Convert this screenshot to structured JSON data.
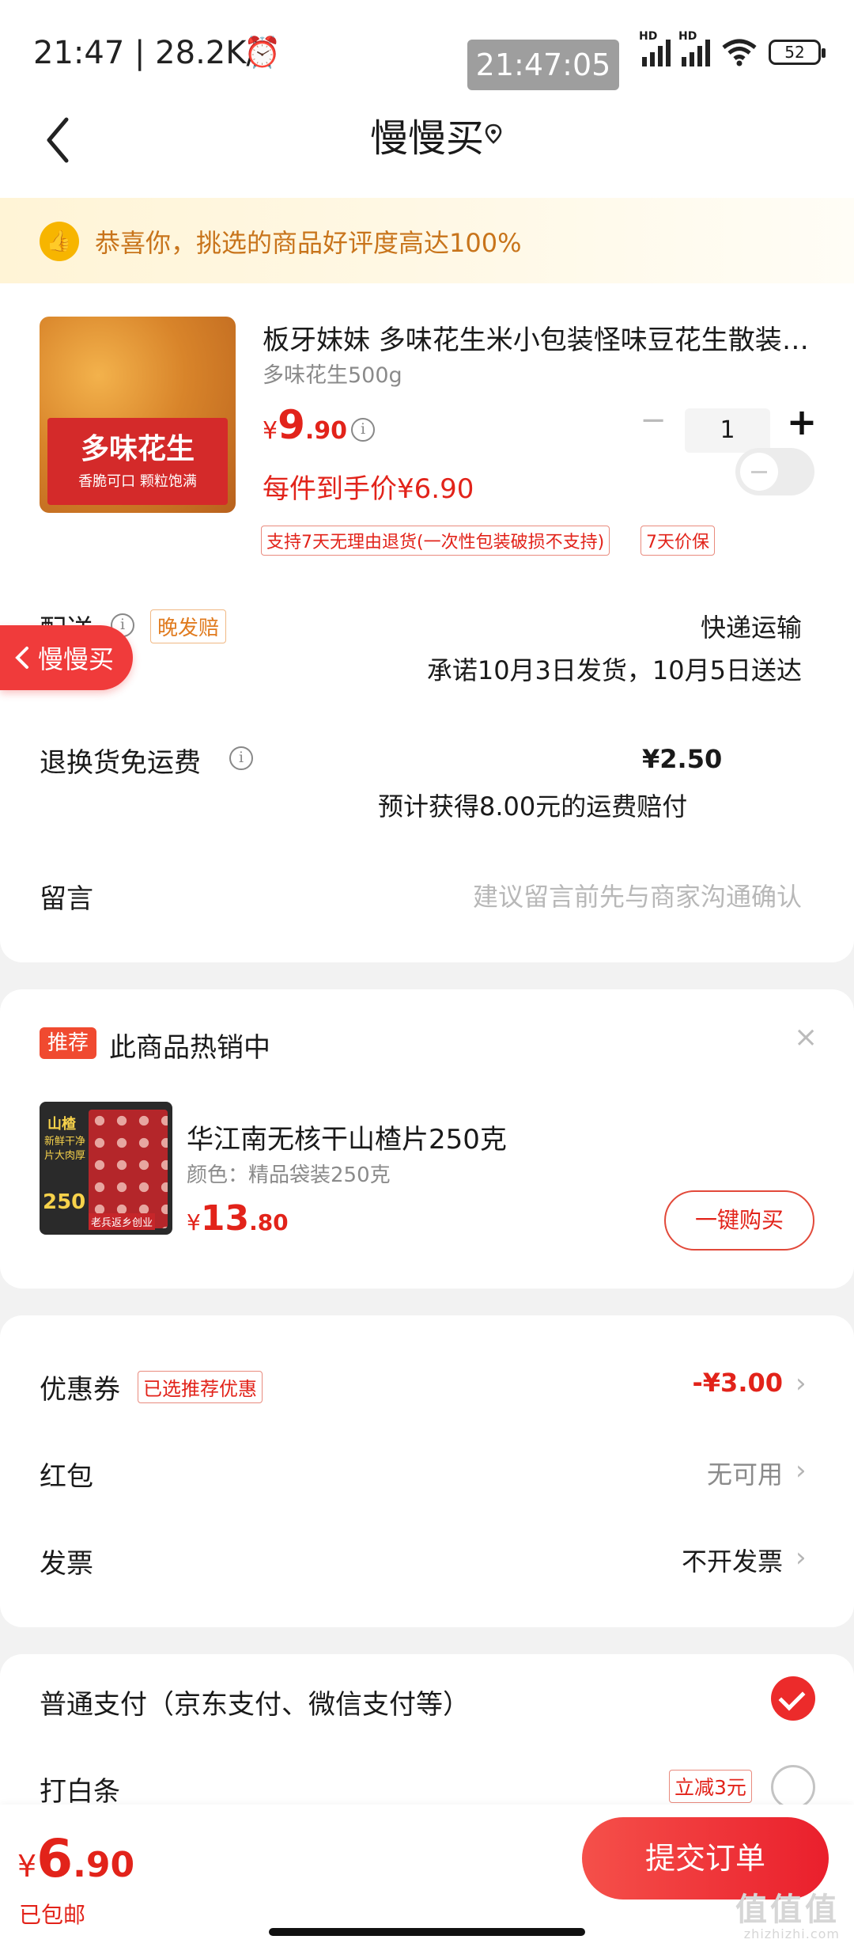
{
  "status_bar": {
    "time_speed": "21:47 | 28.2K/s",
    "overlay_time": "21:47:05",
    "battery": "52",
    "hd": "HD"
  },
  "header": {
    "title": "慢慢买"
  },
  "banner": {
    "text": "恭喜你，挑选的商品好评度高达100%"
  },
  "product": {
    "image_text_main": "多味花生",
    "image_text_sub": "香脆可口  颗粒饱满",
    "title": "板牙妹妹 多味花生米小包装怪味豆花生散装零食",
    "spec": "多味花生500g",
    "price_yen": "¥",
    "price_int": "9",
    "price_dec": ".90",
    "per_price": "每件到手价¥6.90",
    "quantity": "1",
    "tag_return": "支持7天无理由退货(一次性包装破损不支持)",
    "tag_price_protect": "7天价保"
  },
  "delivery": {
    "label": "配送",
    "late_tag": "晚发赔",
    "method": "快递运输",
    "promise": "承诺10月3日发货，10月5日送达"
  },
  "floating_back": {
    "label": "慢慢买"
  },
  "return_shipping": {
    "label": "退换货免运费",
    "price": "¥2.50",
    "note": "预计获得8.00元的运费赔付"
  },
  "message": {
    "label": "留言",
    "placeholder": "建议留言前先与商家沟通确认"
  },
  "recommend": {
    "badge": "推荐",
    "title": "此商品热销中",
    "close": "×",
    "image_t1": "山楂",
    "image_t2": "新鲜干净片大肉厚",
    "image_t3": "250",
    "image_t4": "老兵返乡创业",
    "name": "华江南无核干山楂片250克",
    "spec": "颜色：精品袋装250克",
    "price_yen": "¥",
    "price_int": "13",
    "price_dec": ".80",
    "button": "一键购买"
  },
  "discounts": {
    "coupon_label": "优惠券",
    "coupon_tag": "已选推荐优惠",
    "coupon_value": "-¥3.00",
    "redpacket_label": "红包",
    "redpacket_value": "无可用",
    "invoice_label": "发票",
    "invoice_value": "不开发票"
  },
  "payment": {
    "normal_label": "普通支付（京东支付、微信支付等）",
    "baitiao_label": "打白条",
    "baitiao_tag": "立减3元"
  },
  "bottom": {
    "total_yen": "¥",
    "total_int": "6",
    "total_dec": ".90",
    "shipping_note": "已包邮",
    "submit": "提交订单",
    "watermark": "值值值",
    "watermark_url": "zhizhizhi.com"
  },
  "colors": {
    "accent_red": "#e2231a",
    "banner_text": "#c8741b",
    "tag_orange": "#e07b1f"
  }
}
